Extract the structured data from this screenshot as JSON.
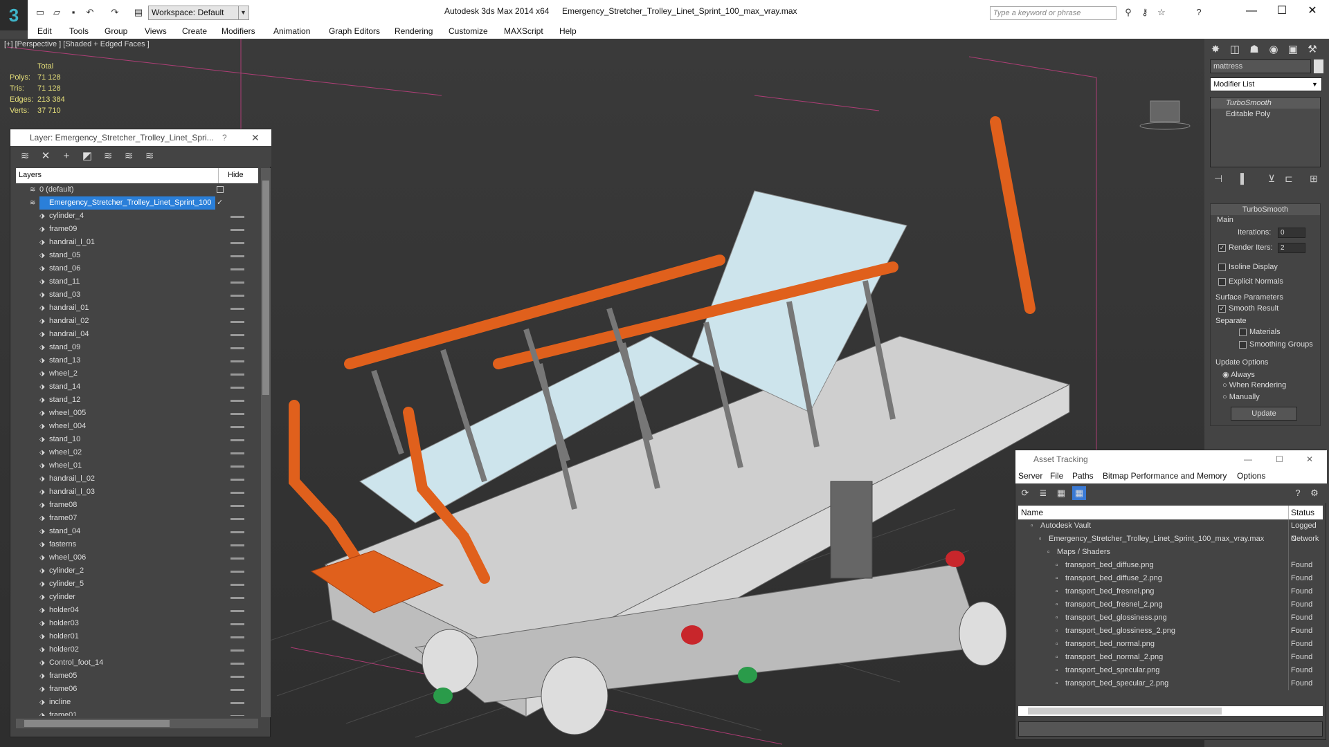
{
  "titlebar": {
    "workspace": "Workspace: Default",
    "app": "Autodesk 3ds Max  2014 x64",
    "file": "Emergency_Stretcher_Trolley_Linet_Sprint_100_max_vray.max",
    "search_placeholder": "Type a keyword or phrase"
  },
  "menu": [
    "Edit",
    "Tools",
    "Group",
    "Views",
    "Create",
    "Modifiers",
    "Animation",
    "Graph Editors",
    "Rendering",
    "Customize",
    "MAXScript",
    "Help"
  ],
  "viewport": {
    "label": "[+] [Perspective ] [Shaded + Edged Faces ]",
    "stats": {
      "header": "Total",
      "polys_label": "Polys:",
      "polys": "71 128",
      "tris_label": "Tris:",
      "tris": "71 128",
      "edges_label": "Edges:",
      "edges": "213 384",
      "verts_label": "Verts:",
      "verts": "37 710"
    }
  },
  "layers": {
    "title": "Layer: Emergency_Stretcher_Trolley_Linet_Spri...",
    "help": "?",
    "col_layers": "Layers",
    "col_hide": "Hide",
    "default_layer": "0 (default)",
    "selected_layer": "Emergency_Stretcher_Trolley_Linet_Sprint_100",
    "items": [
      "cylinder_4",
      "frame09",
      "handrail_l_01",
      "stand_05",
      "stand_06",
      "stand_11",
      "stand_03",
      "handrail_01",
      "handrail_02",
      "handrail_04",
      "stand_09",
      "stand_13",
      "wheel_2",
      "stand_14",
      "stand_12",
      "wheel_005",
      "wheel_004",
      "stand_10",
      "wheel_02",
      "wheel_01",
      "handrail_l_02",
      "handrail_l_03",
      "frame08",
      "frame07",
      "stand_04",
      "fasterns",
      "wheel_006",
      "cylinder_2",
      "cylinder_5",
      "cylinder",
      "holder04",
      "holder03",
      "holder01",
      "holder02",
      "Control_foot_14",
      "frame05",
      "frame06",
      "incline",
      "frame01"
    ]
  },
  "command_panel": {
    "object_name": "mattress",
    "modifier_list": "Modifier List",
    "stack": [
      "TurboSmooth",
      "Editable Poly"
    ],
    "rollout_title": "TurboSmooth",
    "main": "Main",
    "iterations_label": "Iterations:",
    "iterations": "0",
    "render_iters_label": "Render Iters:",
    "render_iters": "2",
    "isoline": "Isoline Display",
    "explicit_normals": "Explicit Normals",
    "surface_params": "Surface Parameters",
    "smooth_result": "Smooth Result",
    "separate": "Separate",
    "materials": "Materials",
    "smoothing_groups": "Smoothing Groups",
    "update_options": "Update Options",
    "always": "Always",
    "when_rendering": "When Rendering",
    "manually": "Manually",
    "update": "Update"
  },
  "asset_tracking": {
    "title": "Asset Tracking",
    "menu": [
      "Server",
      "File",
      "Paths",
      "Bitmap Performance and Memory",
      "Options"
    ],
    "col_name": "Name",
    "col_status": "Status",
    "rows": [
      {
        "name": "Autodesk Vault",
        "status": "Logged C",
        "indent": 1
      },
      {
        "name": "Emergency_Stretcher_Trolley_Linet_Sprint_100_max_vray.max",
        "status": "Network",
        "indent": 2
      },
      {
        "name": "Maps / Shaders",
        "status": "",
        "indent": 3
      },
      {
        "name": "transport_bed_diffuse.png",
        "status": "Found",
        "indent": 4
      },
      {
        "name": "transport_bed_diffuse_2.png",
        "status": "Found",
        "indent": 4
      },
      {
        "name": "transport_bed_fresnel.png",
        "status": "Found",
        "indent": 4
      },
      {
        "name": "transport_bed_fresnel_2.png",
        "status": "Found",
        "indent": 4
      },
      {
        "name": "transport_bed_glossiness.png",
        "status": "Found",
        "indent": 4
      },
      {
        "name": "transport_bed_glossiness_2.png",
        "status": "Found",
        "indent": 4
      },
      {
        "name": "transport_bed_normal.png",
        "status": "Found",
        "indent": 4
      },
      {
        "name": "transport_bed_normal_2.png",
        "status": "Found",
        "indent": 4
      },
      {
        "name": "transport_bed_specular.png",
        "status": "Found",
        "indent": 4
      },
      {
        "name": "transport_bed_specular_2.png",
        "status": "Found",
        "indent": 4
      }
    ]
  }
}
